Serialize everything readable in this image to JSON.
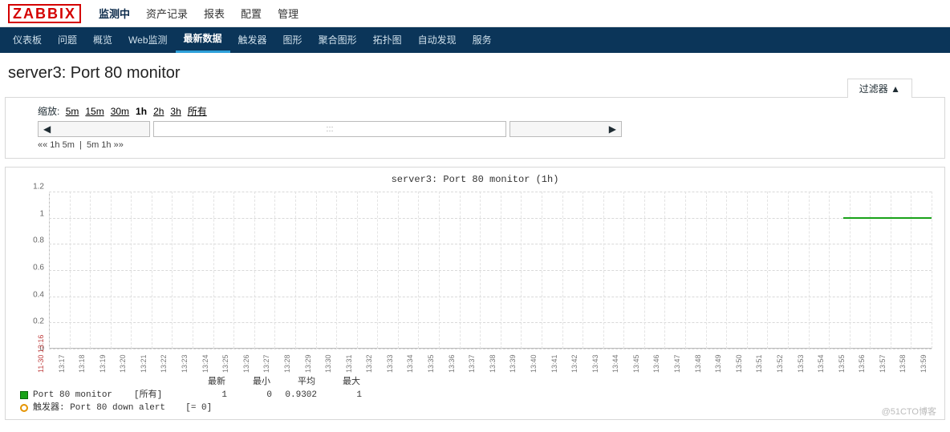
{
  "logo": "ZABBIX",
  "topnav": [
    "监测中",
    "资产记录",
    "报表",
    "配置",
    "管理"
  ],
  "topnav_active": 0,
  "subnav": [
    "仪表板",
    "问题",
    "概览",
    "Web监测",
    "最新数据",
    "触发器",
    "图形",
    "聚合图形",
    "拓扑图",
    "自动发现",
    "服务"
  ],
  "subnav_active": 4,
  "page_title": "server3: Port 80 monitor",
  "filter_tab": "过滤器 ▲",
  "zoom_label": "缩放:",
  "zoom_opts": [
    "5m",
    "15m",
    "30m",
    "1h",
    "2h",
    "3h",
    "所有"
  ],
  "zoom_active": 3,
  "nav_prev": "◀",
  "nav_next": "▶",
  "slider_grip": ":::",
  "bottom_links_left": "«« 1h 5m",
  "bottom_links_right": "5m 1h »»",
  "chart_data": {
    "type": "line",
    "title": "server3: Port 80 monitor (1h)",
    "ylim": [
      0,
      1.2
    ],
    "yticks": [
      0,
      0.2,
      0.4,
      0.6,
      0.8,
      1.0,
      1.2
    ],
    "xticks": [
      "11-30 13:16",
      "13:17",
      "13:18",
      "13:19",
      "13:20",
      "13:21",
      "13:22",
      "13:23",
      "13:24",
      "13:25",
      "13:26",
      "13:27",
      "13:28",
      "13:29",
      "13:30",
      "13:31",
      "13:32",
      "13:33",
      "13:34",
      "13:35",
      "13:36",
      "13:37",
      "13:38",
      "13:39",
      "13:40",
      "13:41",
      "13:42",
      "13:43",
      "13:44",
      "13:45",
      "13:46",
      "13:47",
      "13:48",
      "13:49",
      "13:50",
      "13:51",
      "13:52",
      "13:53",
      "13:54",
      "13:55",
      "13:56",
      "13:57",
      "13:58",
      "13:59"
    ],
    "series": [
      {
        "name": "Port 80 monitor",
        "color": "#19a219",
        "segments": [
          {
            "x0_pct": 90,
            "x1_pct": 100,
            "y": 1.0
          }
        ]
      }
    ],
    "legend_headers": [
      "最新",
      "最小",
      "平均",
      "最大"
    ],
    "legend_rows": [
      {
        "swatch": "green",
        "name": "Port 80 monitor",
        "scope": "[所有]",
        "vals": [
          "1",
          "0",
          "0.9302",
          "1"
        ]
      }
    ],
    "trigger_row": {
      "name": "触发器: Port 80 down alert",
      "cond": "[= 0]"
    }
  },
  "watermark": "@51CTO博客"
}
